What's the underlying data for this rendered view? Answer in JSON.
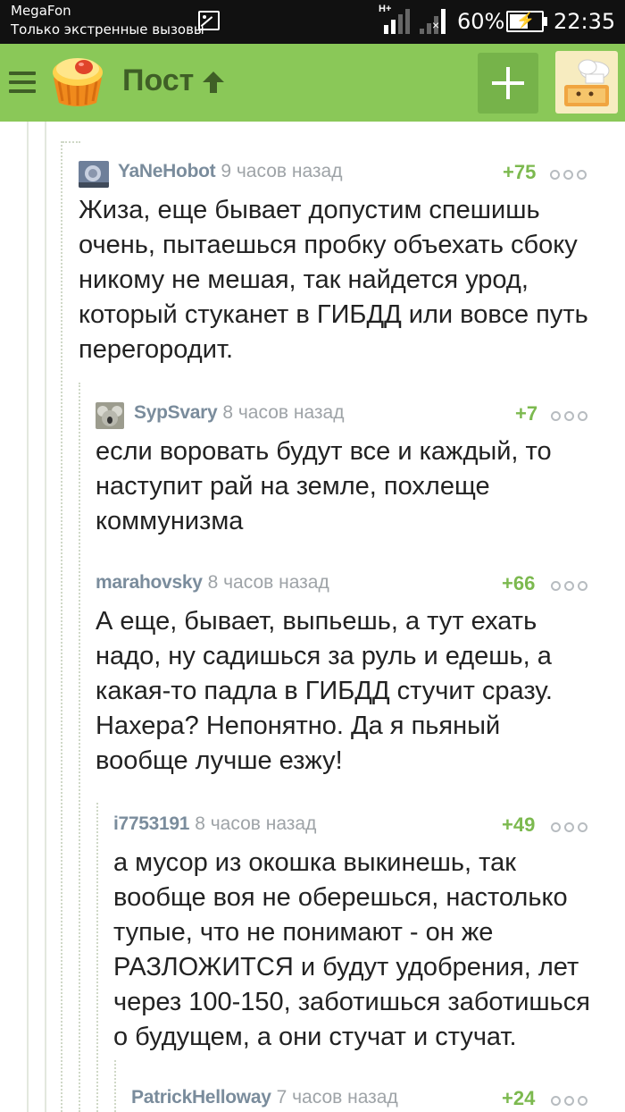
{
  "status_bar": {
    "carrier": "MegaFon",
    "emergency": "Только экстренные вызовы",
    "network_type": "H+",
    "battery_percent": "60%",
    "battery_level": 0.6,
    "time": "22:35"
  },
  "header": {
    "title": "Пост",
    "icons": [
      "menu-icon",
      "pikabu-logo",
      "arrow-up-icon",
      "plus-icon",
      "user-avatar"
    ]
  },
  "colors": {
    "header_bg": "#8ac858",
    "header_dark": "#3f5f26",
    "rating": "#7cb94f",
    "author": "#7a8c9c",
    "time": "#9ea3a7"
  },
  "top_fragment": "-",
  "comments": [
    {
      "author": "YaNeHobot",
      "time": "9 часов назад",
      "rating": "+75",
      "text": "Жиза, еще бывает допустим спешишь\nочень, пытаешься пробку объехать сбоку\nникому не мешая, так найдется урод,\nкоторый стуканет в ГИБДД или вовсе путь\nперегородит."
    },
    {
      "author": "SypSvary",
      "time": "8 часов назад",
      "rating": "+7",
      "text": "если воровать будут все и каждый, то\nнаступит рай на земле, похлеще\nкоммунизма"
    },
    {
      "author": "marahovsky",
      "time": "8 часов назад",
      "rating": "+66",
      "text": "А еще, бывает, выпьешь, а тут ехать\nнадо, ну садишься за руль и едешь, а\nкакая-то падла в ГИБДД стучит сразу.\nНахера? Непонятно. Да я пьяный\nвообще лучше езжу!"
    },
    {
      "author": "i7753191",
      "time": "8 часов назад",
      "rating": "+49",
      "text": "а мусор из окошка выкинешь, так\nвообще воя не оберешься, настолько\nтупые, что не понимают - он же\nРАЗЛОЖИТСЯ и будут удобрения, лет\nчерез 100-150, заботишься заботишься\nо будущем, а они стучат и стучат."
    },
    {
      "author": "PatrickHelloway",
      "time": "7 часов назад",
      "rating": "+24",
      "text": ""
    }
  ]
}
